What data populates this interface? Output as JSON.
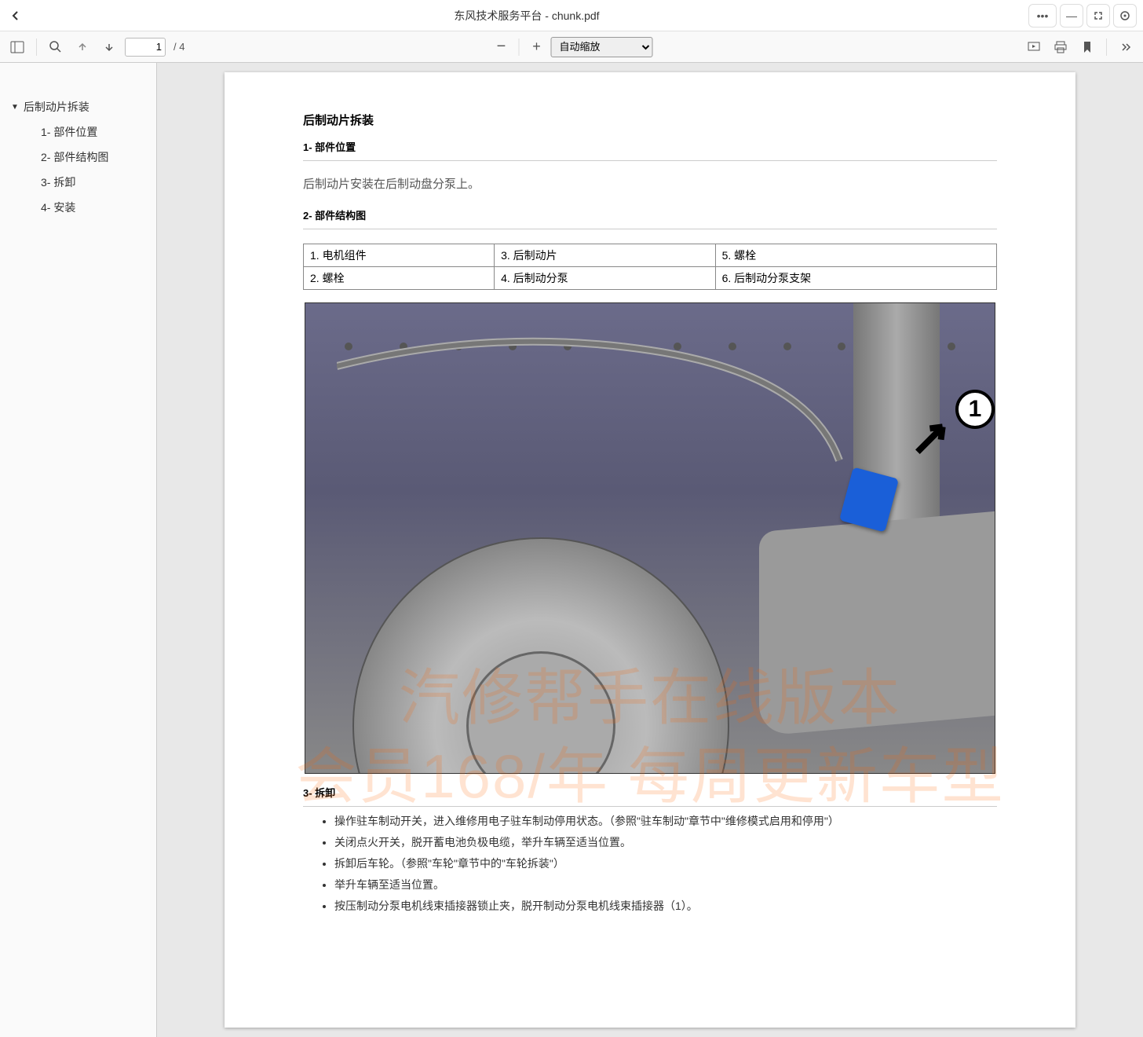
{
  "window": {
    "title": "东风技术服务平台 - chunk.pdf"
  },
  "toolbar": {
    "page_current": "1",
    "page_total": "/ 4",
    "zoom_label": "自动缩放"
  },
  "outline": {
    "root": "后制动片拆装",
    "items": [
      "1- 部件位置",
      "2- 部件结构图",
      "3- 拆卸",
      "4- 安装"
    ]
  },
  "doc": {
    "title": "后制动片拆装",
    "h2_1": "1- 部件位置",
    "p1": "后制动片安装在后制动盘分泵上。",
    "h2_2": "2- 部件结构图",
    "table": {
      "r1c1": "1. 电机组件",
      "r1c2": "3. 后制动片",
      "r1c3": "5. 螺栓",
      "r2c1": "2. 螺栓",
      "r2c2": "4. 后制动分泵",
      "r2c3": "6. 后制动分泵支架"
    },
    "callout1": "1",
    "h2_3": "3- 拆卸",
    "steps": [
      "操作驻车制动开关，进入维修用电子驻车制动停用状态。（参照\"驻车制动\"章节中\"维修模式启用和停用\"）",
      "关闭点火开关，脱开蓄电池负极电缆，举升车辆至适当位置。",
      "拆卸后车轮。（参照\"车轮\"章节中的\"车轮拆装\"）",
      "举升车辆至适当位置。",
      "按压制动分泵电机线束插接器锁止夹，脱开制动分泵电机线束插接器（1）。"
    ],
    "watermark1": "汽修帮手在线版本",
    "watermark2": "会员168/年 每周更新车型"
  }
}
